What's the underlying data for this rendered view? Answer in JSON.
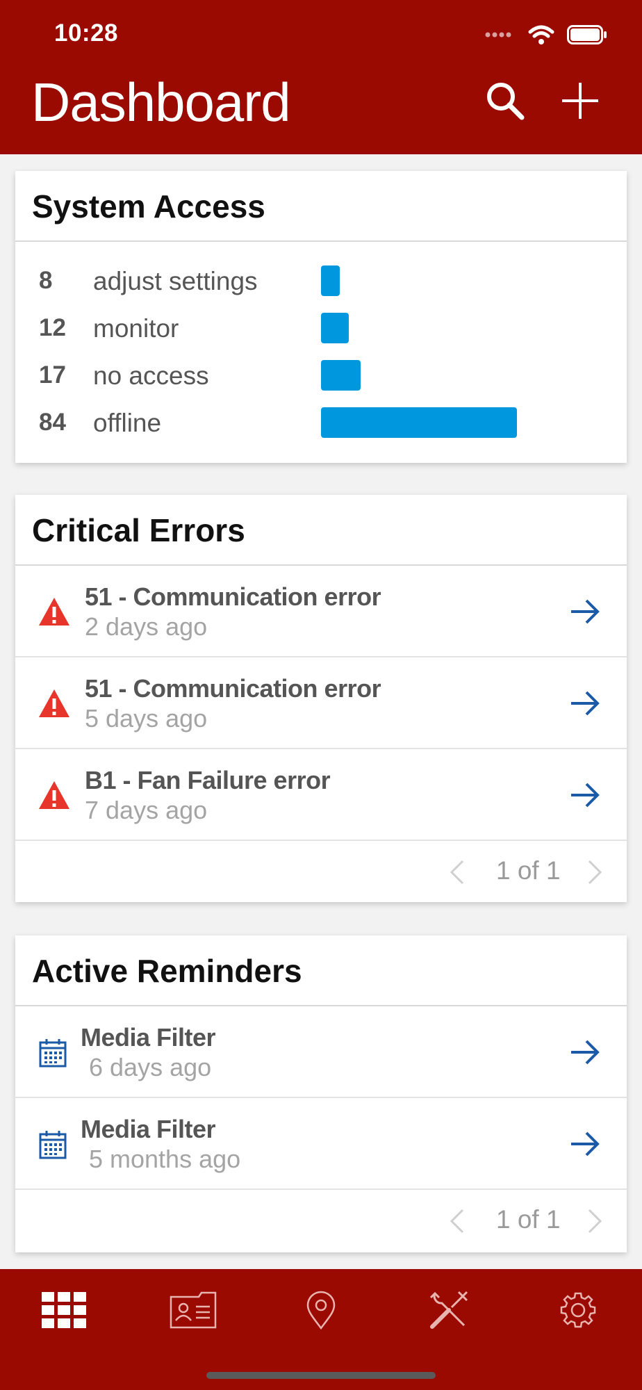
{
  "status_bar": {
    "time": "10:28"
  },
  "header": {
    "title": "Dashboard",
    "search_icon": "search-icon",
    "add_icon": "plus-icon"
  },
  "colors": {
    "brand": "#9b0a00",
    "bar": "#0097de",
    "link": "#1b5aa6",
    "error": "#e8352b"
  },
  "system_access": {
    "title": "System Access",
    "rows": [
      {
        "count": "8",
        "label": "adjust settings",
        "value": 8
      },
      {
        "count": "12",
        "label": "monitor",
        "value": 12
      },
      {
        "count": "17",
        "label": "no access",
        "value": 17
      },
      {
        "count": "84",
        "label": "offline",
        "value": 84
      }
    ]
  },
  "critical_errors": {
    "title": "Critical Errors",
    "items": [
      {
        "title": "51 -  Communication error",
        "time": "2 days ago"
      },
      {
        "title": "51 -  Communication error",
        "time": "5 days ago"
      },
      {
        "title": "B1 - Fan Failure error",
        "time": "7 days ago"
      }
    ],
    "pager": "1 of 1"
  },
  "active_reminders": {
    "title": "Active Reminders",
    "items": [
      {
        "title": "Media Filter",
        "time": "6 days ago"
      },
      {
        "title": "Media Filter",
        "time": "5 months ago"
      }
    ],
    "pager": "1 of 1"
  },
  "tabbar": {
    "tabs": [
      {
        "icon": "grid-icon",
        "selected": true
      },
      {
        "icon": "contact-card-icon",
        "selected": false
      },
      {
        "icon": "location-pin-icon",
        "selected": false
      },
      {
        "icon": "tools-icon",
        "selected": false
      },
      {
        "icon": "gear-icon",
        "selected": false
      }
    ]
  }
}
